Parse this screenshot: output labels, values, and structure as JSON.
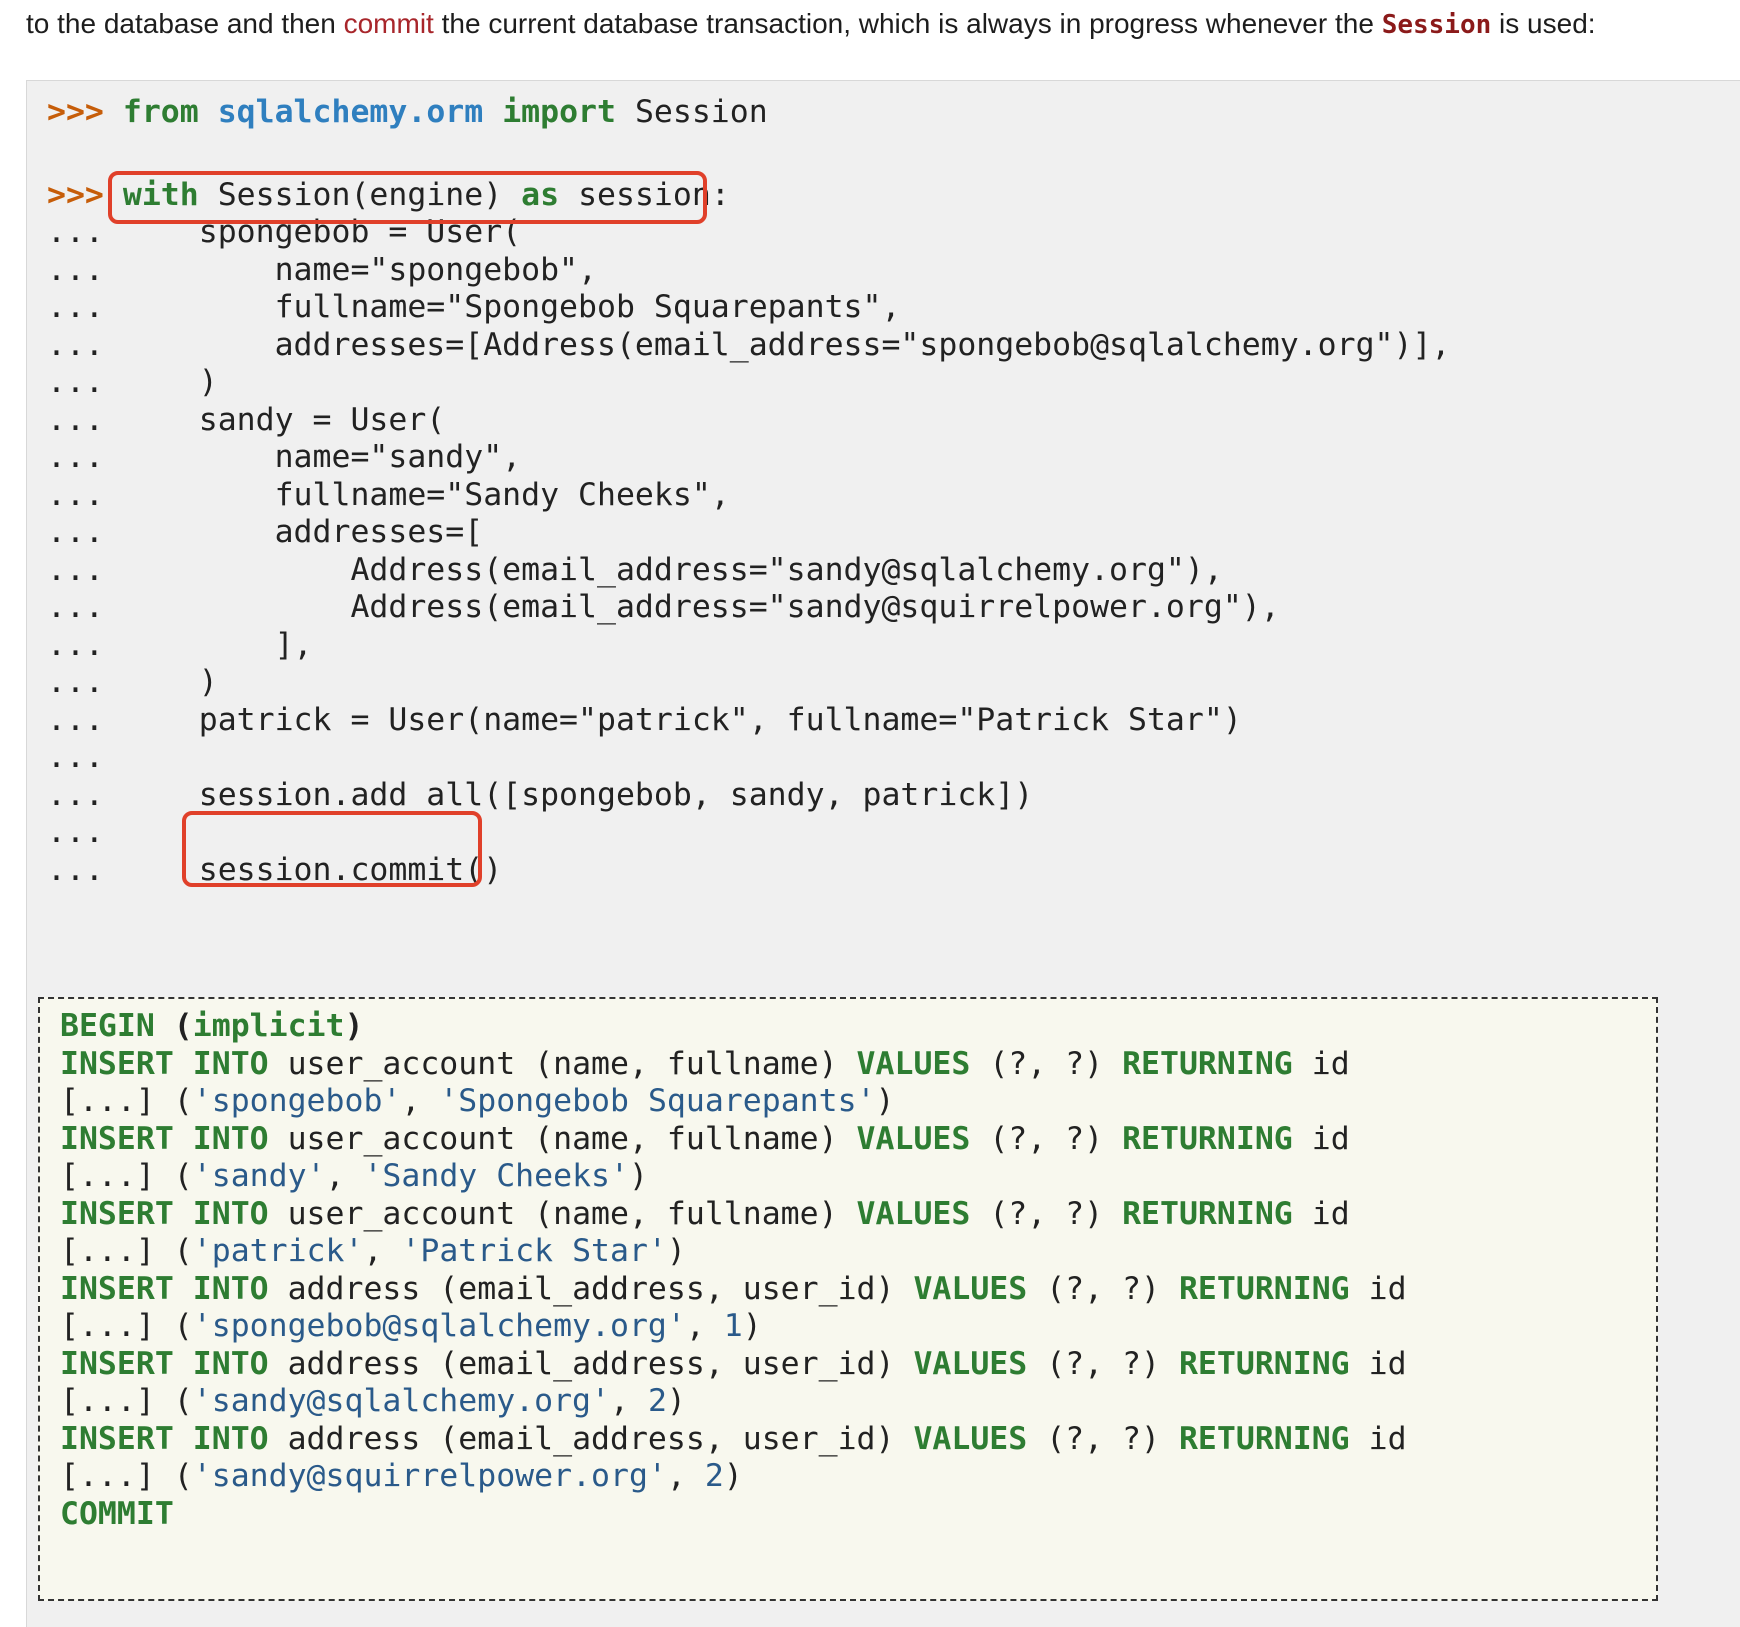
{
  "intro": {
    "before": "to the database and then ",
    "link": "commit",
    "middle": " the current database transaction, which is always in progress whenever the ",
    "code": "Session",
    "after": " is used:"
  },
  "code": {
    "l1": {
      "prompt": ">>>",
      "kw1": "from",
      "mod": "sqlalchemy.orm",
      "kw2": "import",
      "rest": "Session"
    },
    "l2": {
      "prompt": ">>>",
      "kw1": "with",
      "mid": "Session(engine)",
      "kw2": "as",
      "rest": "session:"
    },
    "cont_prompt": "...",
    "lines": [
      "    spongebob = User(",
      "        name=\"spongebob\",",
      "        fullname=\"Spongebob Squarepants\",",
      "        addresses=[Address(email_address=\"spongebob@sqlalchemy.org\")],",
      "    )",
      "    sandy = User(",
      "        name=\"sandy\",",
      "        fullname=\"Sandy Cheeks\",",
      "        addresses=[",
      "            Address(email_address=\"sandy@sqlalchemy.org\"),",
      "            Address(email_address=\"sandy@squirrelpower.org\"),",
      "        ],",
      "    )",
      "    patrick = User(name=\"patrick\", fullname=\"Patrick Star\")",
      "",
      "    session.add_all([spongebob, sandy, patrick])",
      "",
      "    session.commit()"
    ]
  },
  "sql": {
    "begin": "BEGIN",
    "implicit": "(implicit)",
    "insert": "INSERT",
    "into": "INTO",
    "values": "VALUES",
    "returning": "RETURNING",
    "placeholders": "(?, ?)",
    "id": "id",
    "ellipsis": "[...]",
    "user_table": "user_account (name, fullname)",
    "address_table": "address (email_address, user_id)",
    "params": [
      {
        "a": "'spongebob'",
        "b": "'Spongebob Squarepants'"
      },
      {
        "a": "'sandy'",
        "b": "'Sandy Cheeks'"
      },
      {
        "a": "'patrick'",
        "b": "'Patrick Star'"
      },
      {
        "a": "'spongebob@sqlalchemy.org'",
        "b": "1"
      },
      {
        "a": "'sandy@sqlalchemy.org'",
        "b": "2"
      },
      {
        "a": "'sandy@squirrelpower.org'",
        "b": "2"
      }
    ],
    "commit": "COMMIT"
  }
}
